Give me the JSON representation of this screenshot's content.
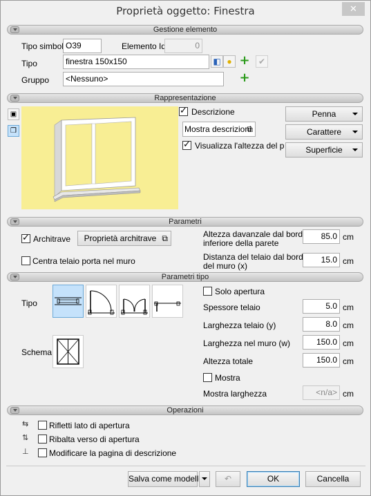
{
  "window": {
    "title": "Proprietà oggetto: Finestra",
    "close_glyph": "✕"
  },
  "sections": {
    "gestione": "Gestione elemento",
    "rappresentazione": "Rappresentazione",
    "parametri": "Parametri",
    "parametri_tipo": "Parametri tipo",
    "operazioni": "Operazioni"
  },
  "gestione": {
    "tipo_simbolo_label": "Tipo simbolo",
    "tipo_simbolo_value": "O39",
    "elemento_id_label": "Elemento Id",
    "elemento_id_value": "0",
    "tipo_label": "Tipo",
    "tipo_value": "finestra 150x150",
    "gruppo_label": "Gruppo",
    "gruppo_value": "<Nessuno>"
  },
  "rappresentazione": {
    "descrizione_label": "Descrizione",
    "descrizione_checked": true,
    "mostra_descrizioni_label": "Mostra descrizioni",
    "visualizza_altezza_label": "Visualizza l'altezza del parap",
    "visualizza_altezza_checked": true,
    "penna_label": "Penna",
    "carattere_label": "Carattere",
    "superficie_label": "Superficie",
    "preview_color": "#f8ee94"
  },
  "parametri": {
    "architrave_label": "Architrave",
    "architrave_checked": true,
    "proprieta_architrave_label": "Proprietà architrave",
    "centra_telaio_label": "Centra telaio porta nel muro",
    "centra_telaio_checked": false,
    "altezza_davanzale_label_1": "Altezza davanzale dal bordo",
    "altezza_davanzale_label_2": "inferiore della parete",
    "altezza_davanzale_value": "85.0",
    "distanza_telaio_label_1": "Distanza del telaio dal bordo",
    "distanza_telaio_label_2": "del muro (x)",
    "distanza_telaio_value": "15.0",
    "unit": "cm"
  },
  "parametri_tipo": {
    "tipo_label": "Tipo",
    "schema_label": "Schema",
    "solo_apertura_label": "Solo apertura",
    "solo_apertura_checked": false,
    "spessore_telaio_label": "Spessore telaio",
    "spessore_telaio_value": "5.0",
    "larghezza_telaio_label": "Larghezza telaio (y)",
    "larghezza_telaio_value": "8.0",
    "larghezza_muro_label": "Larghezza nel muro (w)",
    "larghezza_muro_value": "150.0",
    "altezza_totale_label": "Altezza totale",
    "altezza_totale_value": "150.0",
    "mostra_label": "Mostra",
    "mostra_checked": false,
    "mostra_larghezza_label": "Mostra larghezza",
    "mostra_larghezza_value": "<n/a>",
    "unit": "cm"
  },
  "operazioni": {
    "rifletti_label": "Rifletti lato di apertura",
    "ribalta_label": "Ribalta verso di apertura",
    "modificare_label": "Modificare la pagina di descrizione"
  },
  "footer": {
    "salva_label": "Salva come modello",
    "ok_label": "OK",
    "cancella_label": "Cancella"
  }
}
